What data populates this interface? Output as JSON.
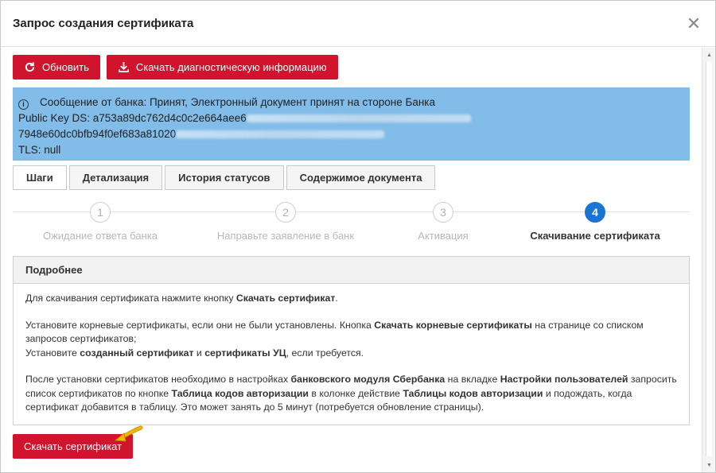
{
  "dialog": {
    "title": "Запрос создания сертификата",
    "close_glyph": "✕"
  },
  "toolbar": {
    "refresh_label": "Обновить",
    "download_diag_label": "Скачать диагностическую информацию"
  },
  "alert": {
    "info_glyph": "i",
    "message": "Сообщение от банка: Принят, Электронный документ принят на стороне Банка",
    "public_key_line1": "Public Key DS: a753a89dc762d4c0c2e664aee6",
    "public_key_line2": "7948e60dc0bfb94f0ef683a81020",
    "tls": "TLS: null"
  },
  "tabs": [
    {
      "label": "Шаги",
      "active": true
    },
    {
      "label": "Детализация",
      "active": false
    },
    {
      "label": "История статусов",
      "active": false
    },
    {
      "label": "Содержимое документа",
      "active": false
    }
  ],
  "steps": [
    {
      "num": "1",
      "label": "Ожидание ответа банка",
      "active": false
    },
    {
      "num": "2",
      "label": "Направьте заявление в банк",
      "active": false
    },
    {
      "num": "3",
      "label": "Активация",
      "active": false
    },
    {
      "num": "4",
      "label": "Скачивание сертификата",
      "active": true
    }
  ],
  "details": {
    "heading": "Подробнее",
    "p1_a": "Для скачивания сертификата нажмите кнопку ",
    "p1_b": "Скачать сертификат",
    "p1_c": ".",
    "p2_a": "Установите корневые сертификаты, если они не были установлены. Кнопка ",
    "p2_b": "Скачать корневые сертификаты",
    "p2_c": " на странице со списком запросов сертификатов;",
    "p3_a": "Установите ",
    "p3_b": "созданный сертификат",
    "p3_c": " и ",
    "p3_d": "сертификаты УЦ",
    "p3_e": ", если требуется.",
    "p4_a": "После установки сертификатов необходимо в настройках ",
    "p4_b": "банковского модуля Сбербанка",
    "p4_c": " на вкладке ",
    "p4_d": "Настройки пользователей",
    "p4_e": " запросить список сертификатов по кнопке ",
    "p4_f": "Таблица кодов авторизации",
    "p4_g": " в колонке действие ",
    "p4_h": "Таблицы кодов авторизации",
    "p4_i": " и подождать, когда сертификат добавится в таблицу. Это может занять до 5 минут (потребуется обновление страницы)."
  },
  "download_cert_label": "Скачать сертификат",
  "colors": {
    "brand_red": "#d0142e",
    "alert_blue": "#82bce8",
    "step_active": "#1a74d4",
    "pointer_arrow": "#f2b600"
  }
}
